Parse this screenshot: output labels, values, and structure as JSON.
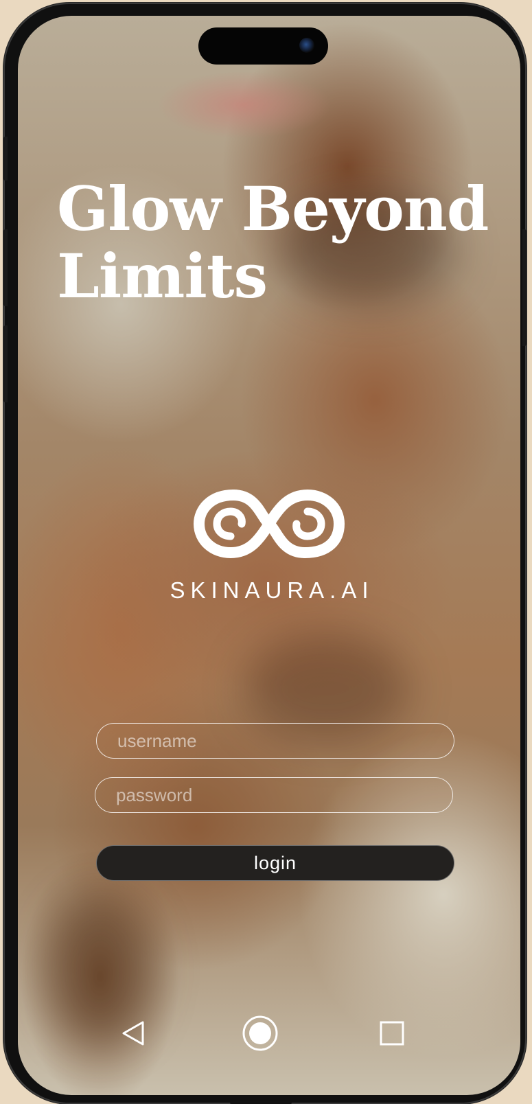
{
  "hero": {
    "headline_line1": "Glow Beyond",
    "headline_line2": "Limits"
  },
  "brand": {
    "logo_icon": "infinity-logo-icon",
    "name": "SKINAURA.AI"
  },
  "login_form": {
    "username_placeholder": "username",
    "username_value": "",
    "password_placeholder": "password",
    "password_value": "",
    "login_label": "login"
  },
  "nav_bar": {
    "back_icon": "triangle-back-icon",
    "home_icon": "circle-home-icon",
    "recents_icon": "square-recents-icon"
  },
  "colors": {
    "background": "#ead9c0",
    "text": "#ffffff",
    "button": "#23211f"
  }
}
